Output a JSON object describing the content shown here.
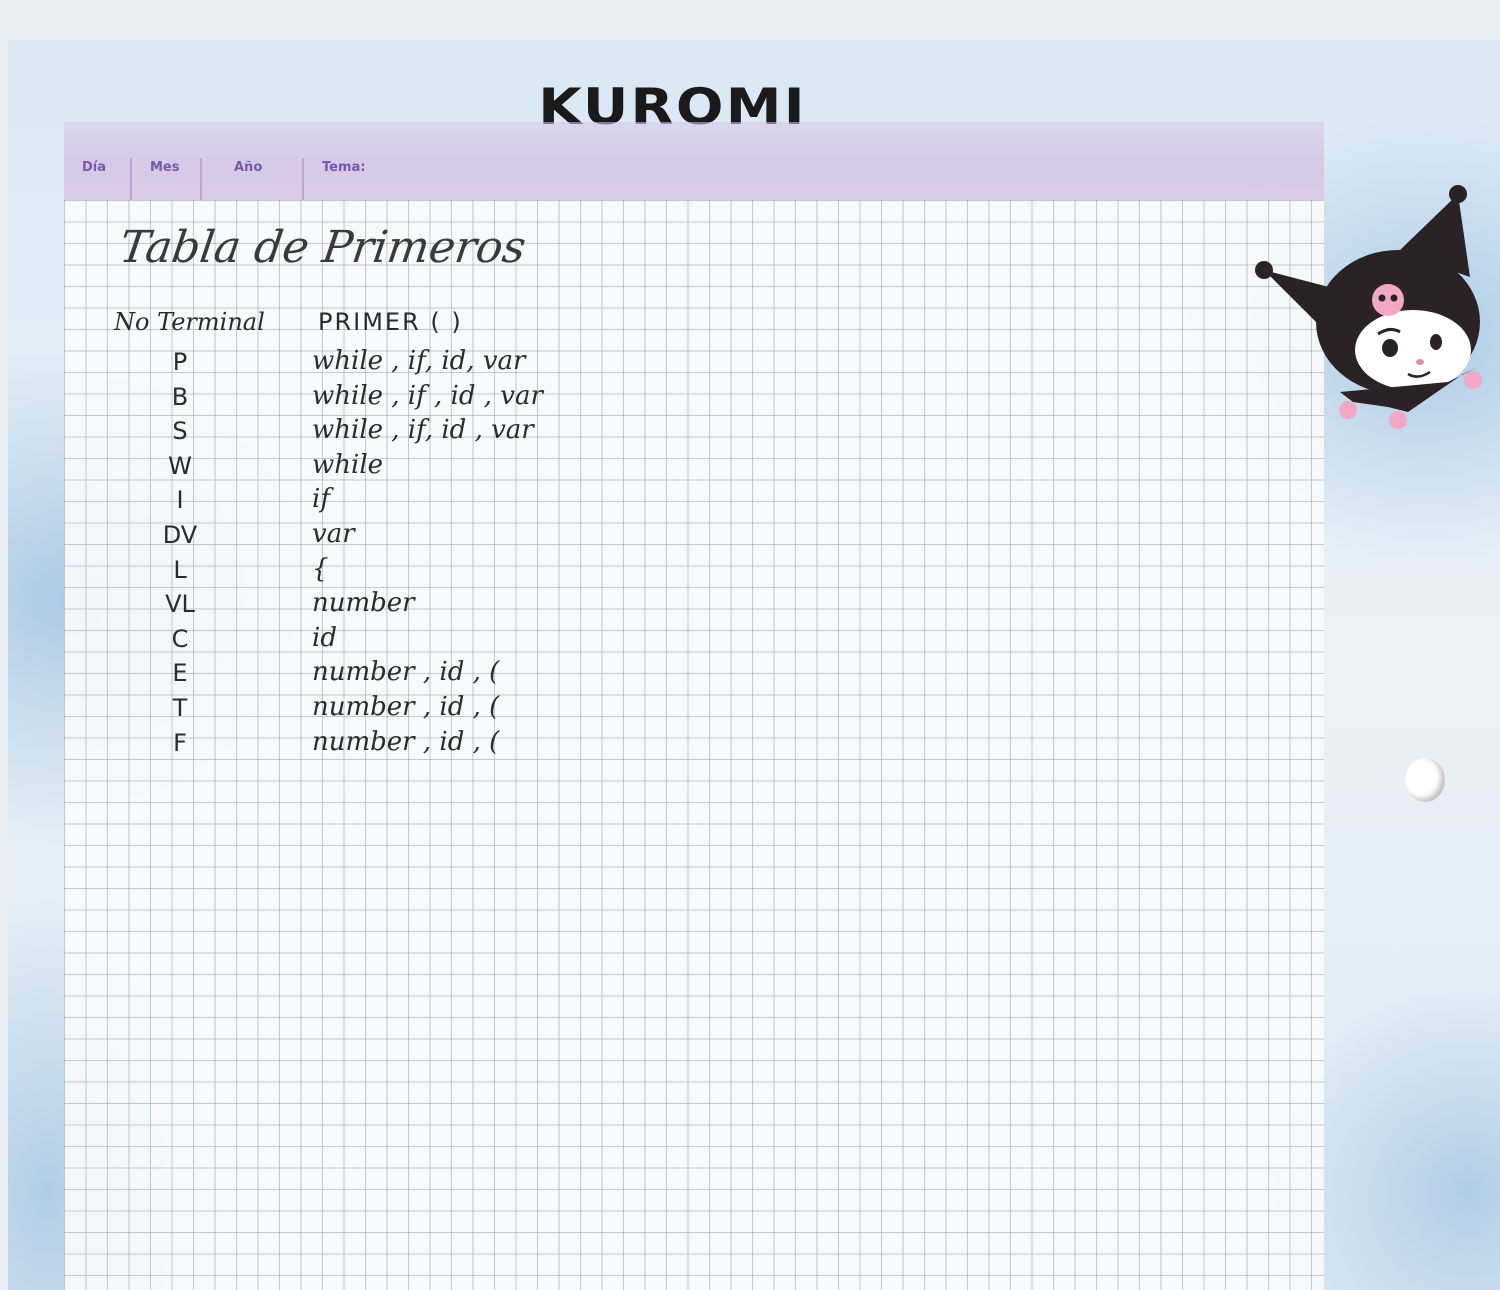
{
  "title": "KUROMI",
  "header": {
    "day": "Día",
    "month": "Mes",
    "year": "Año",
    "topic": "Tema:"
  },
  "notes": {
    "heading": "Tabla de Primeros",
    "col_nonterminal": "No Terminal",
    "col_first": "PRIMER ( )",
    "rows": [
      {
        "nt": "P",
        "first": "while , if, id, var"
      },
      {
        "nt": "B",
        "first": "while , if , id , var"
      },
      {
        "nt": "S",
        "first": "while , if, id , var"
      },
      {
        "nt": "W",
        "first": "while"
      },
      {
        "nt": "I",
        "first": "if"
      },
      {
        "nt": "DV",
        "first": "var"
      },
      {
        "nt": "L",
        "first": "{"
      },
      {
        "nt": "VL",
        "first": "number"
      },
      {
        "nt": "C",
        "first": "id"
      },
      {
        "nt": "E",
        "first": "number , id , ("
      },
      {
        "nt": "T",
        "first": "number , id , ("
      },
      {
        "nt": "F",
        "first": "number , id , ("
      }
    ]
  },
  "colors": {
    "header_band": "#d8cbe8",
    "header_text": "#7a58a8",
    "sheet_blue": "#9cc0e0"
  },
  "decorations": [
    "kuromi-character-illustration",
    "binder-hole"
  ]
}
